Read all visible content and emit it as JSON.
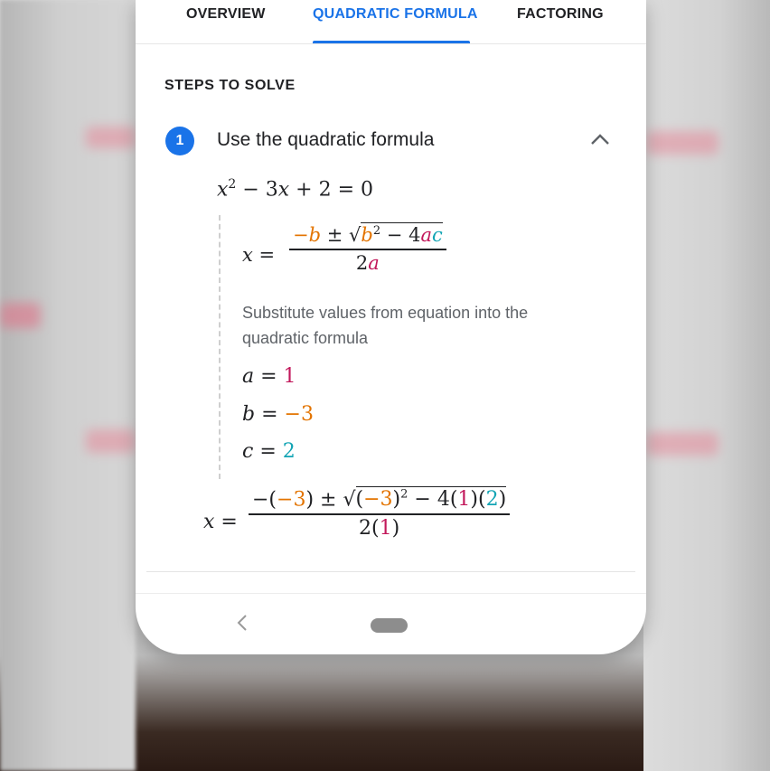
{
  "tabs": [
    {
      "label": "OVERVIEW",
      "active": false
    },
    {
      "label": "QUADRATIC FORMULA",
      "active": true
    },
    {
      "label": "FACTORING",
      "active": false
    }
  ],
  "steps_heading": "STEPS TO SOLVE",
  "step": {
    "number": "1",
    "title": "Use the quadratic formula",
    "expanded": true,
    "chevron_icon": "chevron-up-icon"
  },
  "equation": "x² − 3x + 2 = 0",
  "formula": {
    "lhs": "x =",
    "numerator": "−b ± √b² − 4ac",
    "denominator": "2a"
  },
  "description": "Substitute values from equation into the quadratic formula",
  "coefficients": [
    {
      "name": "a",
      "value": "1",
      "color": "#c2185b"
    },
    {
      "name": "b",
      "value": "−3",
      "color": "#e37400"
    },
    {
      "name": "c",
      "value": "2",
      "color": "#12a4b4"
    }
  ],
  "substituted": {
    "lhs": "x =",
    "numerator": "−(−3) ± √(−3)² − 4(1)(2)",
    "denominator": "2(1)"
  },
  "navbar": {
    "back_icon": "back-chevron-icon",
    "home_icon": "home-pill-icon"
  },
  "colors": {
    "accent": "#1a73e8",
    "a": "#c2185b",
    "b": "#e37400",
    "c": "#12a4b4"
  }
}
